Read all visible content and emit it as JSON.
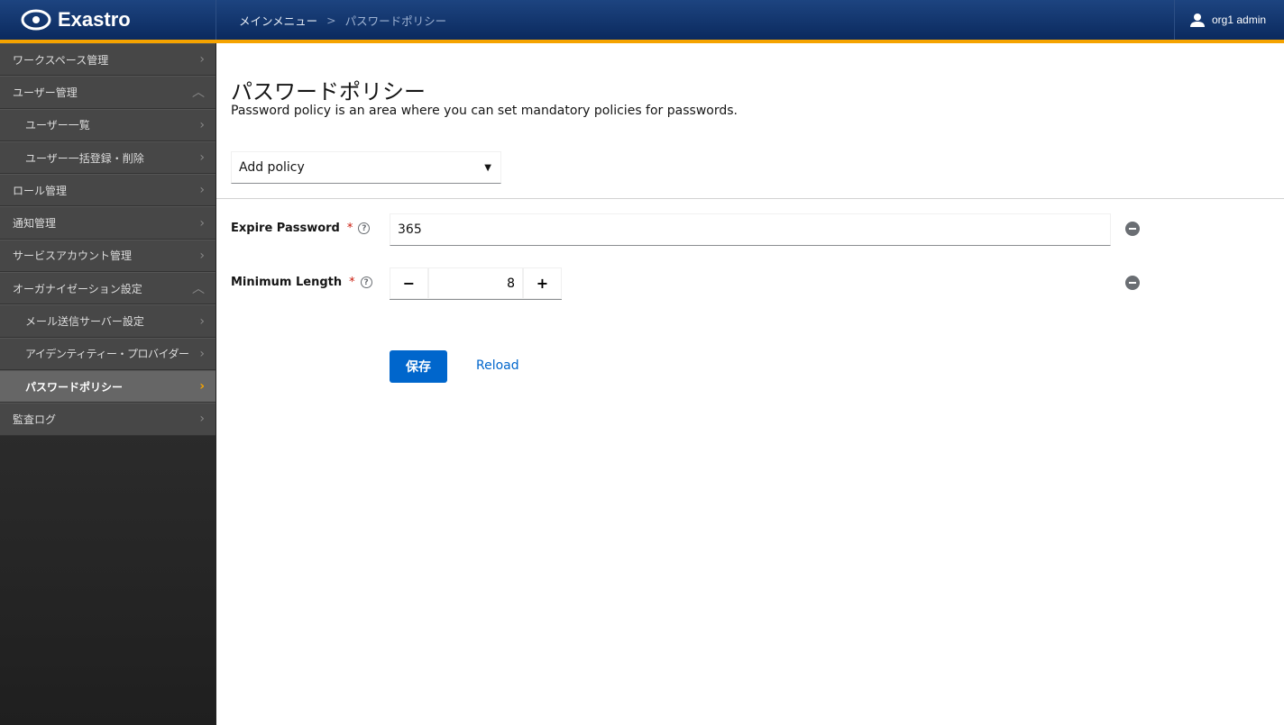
{
  "header": {
    "logo": "Exastro",
    "breadcrumb": [
      "メインメニュー",
      "パスワードポリシー"
    ],
    "user": "org1 admin"
  },
  "sidebar": {
    "items": [
      {
        "label": "ワークスペース管理",
        "icon": "chevron-right"
      },
      {
        "label": "ユーザー管理",
        "icon": "chevron-up"
      },
      {
        "label": "ユーザー一覧",
        "icon": "chevron-right"
      },
      {
        "label": "ユーザー一括登録・削除",
        "icon": "chevron-right"
      },
      {
        "label": "ロール管理",
        "icon": "chevron-right"
      },
      {
        "label": "通知管理",
        "icon": "chevron-right"
      },
      {
        "label": "サービスアカウント管理",
        "icon": "chevron-right"
      },
      {
        "label": "オーガナイゼーション設定",
        "icon": "chevron-up"
      },
      {
        "label": "メール送信サーバー設定",
        "icon": "chevron-right"
      },
      {
        "label": "アイデンティティー・プロバイダー",
        "icon": "chevron-right"
      },
      {
        "label": "パスワードポリシー",
        "icon": "chevron-right",
        "active": true
      },
      {
        "label": "監査ログ",
        "icon": "chevron-right"
      }
    ]
  },
  "main": {
    "title": "パスワードポリシー",
    "description": "Password policy is an area where you can set mandatory policies for passwords.",
    "add_policy": "Add policy",
    "fields": [
      {
        "label": "Expire Password",
        "required": "*",
        "value": "365"
      },
      {
        "label": "Minimum Length",
        "required": "*",
        "value": "8",
        "decrement": "−",
        "increment": "+"
      }
    ],
    "save": "保存",
    "reload": "Reload"
  },
  "colors": {
    "accent": "#f5a300",
    "primary": "#0066cc",
    "header": "#0b2a5e"
  }
}
